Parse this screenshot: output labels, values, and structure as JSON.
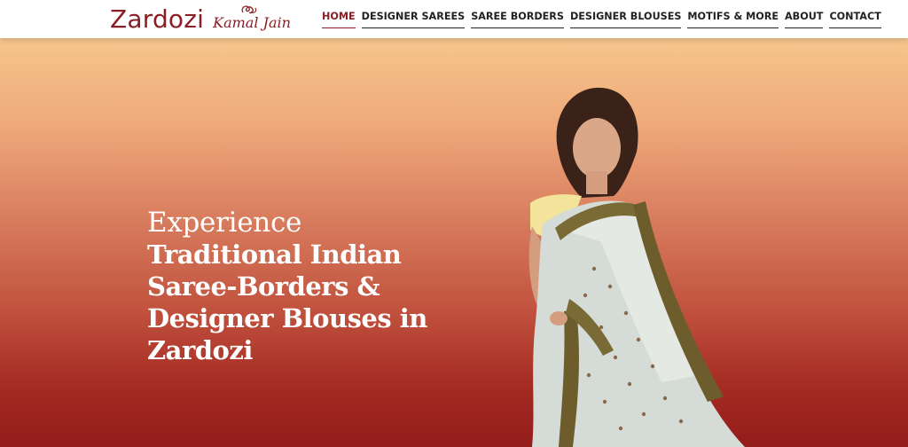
{
  "brand": {
    "name": "Zardozi",
    "signature": "Kamal Jain",
    "colors": {
      "primary": "#8a1e24",
      "hero_top": "#f6c68e",
      "hero_bottom": "#931c1a"
    }
  },
  "nav": {
    "items": [
      {
        "label": "HOME",
        "active": true
      },
      {
        "label": "DESIGNER SAREES",
        "active": false
      },
      {
        "label": "SAREE BORDERS",
        "active": false
      },
      {
        "label": "DESIGNER BLOUSES",
        "active": false
      },
      {
        "label": "MOTIFS & MORE",
        "active": false
      },
      {
        "label": "ABOUT",
        "active": false
      },
      {
        "label": "CONTACT",
        "active": false
      }
    ]
  },
  "hero": {
    "line1": "Experience",
    "line2": "Traditional Indian Saree-Borders & Designer Blouses in Zardozi",
    "image": "woman-in-embroidered-saree"
  }
}
